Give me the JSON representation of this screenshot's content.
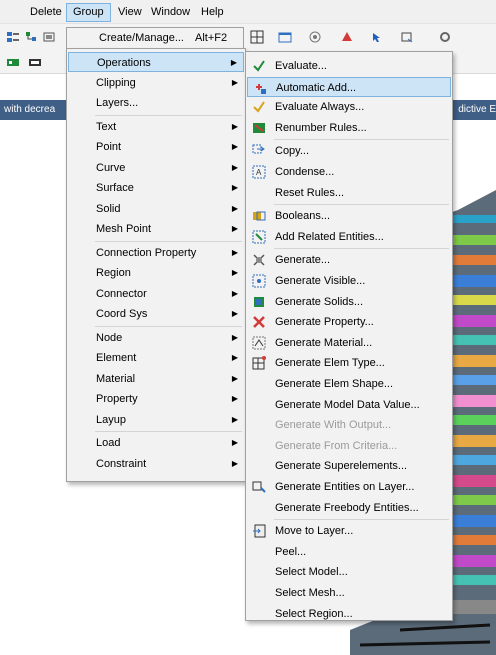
{
  "menubar": {
    "items": [
      "Delete",
      "Group",
      "View",
      "Window",
      "Help"
    ],
    "active": "Group"
  },
  "strip": {
    "left_text": "with decrea",
    "right_text": "dictive E"
  },
  "create_manage": {
    "label": "Create/Manage...",
    "shortcut": "Alt+F2"
  },
  "group_menu": {
    "items": [
      {
        "label": "Operations",
        "submenu": true,
        "highlighted": true
      },
      {
        "label": "Clipping",
        "submenu": true
      },
      {
        "label": "Layers...",
        "submenu": false
      },
      {
        "label": "Text",
        "submenu": true
      },
      {
        "label": "Point",
        "submenu": true
      },
      {
        "label": "Curve",
        "submenu": true
      },
      {
        "label": "Surface",
        "submenu": true
      },
      {
        "label": "Solid",
        "submenu": true
      },
      {
        "label": "Mesh Point",
        "submenu": true
      },
      {
        "label": "Connection Property",
        "submenu": true
      },
      {
        "label": "Region",
        "submenu": true
      },
      {
        "label": "Connector",
        "submenu": true
      },
      {
        "label": "Coord Sys",
        "submenu": true
      },
      {
        "label": "Node",
        "submenu": true
      },
      {
        "label": "Element",
        "submenu": true
      },
      {
        "label": "Material",
        "submenu": true
      },
      {
        "label": "Property",
        "submenu": true
      },
      {
        "label": "Layup",
        "submenu": true
      },
      {
        "label": "Load",
        "submenu": true
      },
      {
        "label": "Constraint",
        "submenu": true
      }
    ]
  },
  "operations_menu": {
    "items": [
      {
        "label": "Evaluate...",
        "icon": "evaluate-icon"
      },
      {
        "label": "Automatic Add...",
        "icon": "automatic-add-icon",
        "highlighted": true
      },
      {
        "label": "Evaluate Always...",
        "icon": "evaluate-always-icon"
      },
      {
        "label": "Renumber Rules...",
        "icon": "renumber-rules-icon"
      },
      {
        "label": "Copy...",
        "icon": "copy-icon"
      },
      {
        "label": "Condense...",
        "icon": "condense-icon"
      },
      {
        "label": "Reset Rules...",
        "icon": ""
      },
      {
        "label": "Booleans...",
        "icon": "booleans-icon"
      },
      {
        "label": "Add Related Entities...",
        "icon": "add-related-icon"
      },
      {
        "label": "Generate...",
        "icon": "generate-icon"
      },
      {
        "label": "Generate Visible...",
        "icon": "generate-visible-icon"
      },
      {
        "label": "Generate Solids...",
        "icon": "generate-solids-icon"
      },
      {
        "label": "Generate Property...",
        "icon": "generate-property-icon"
      },
      {
        "label": "Generate Material...",
        "icon": "generate-material-icon"
      },
      {
        "label": "Generate Elem Type...",
        "icon": "generate-elem-type-icon"
      },
      {
        "label": "Generate Elem Shape...",
        "icon": ""
      },
      {
        "label": "Generate Model Data Value...",
        "icon": ""
      },
      {
        "label": "Generate With Output...",
        "icon": "",
        "disabled": true
      },
      {
        "label": "Generate From Criteria...",
        "icon": "",
        "disabled": true
      },
      {
        "label": "Generate Superelements...",
        "icon": ""
      },
      {
        "label": "Generate Entities on Layer...",
        "icon": "generate-layer-icon"
      },
      {
        "label": "Generate Freebody Entities...",
        "icon": ""
      },
      {
        "label": "Move to Layer...",
        "icon": "move-to-layer-icon"
      },
      {
        "label": "Peel...",
        "icon": ""
      },
      {
        "label": "Select Model...",
        "icon": ""
      },
      {
        "label": "Select Mesh...",
        "icon": ""
      },
      {
        "label": "Select Region...",
        "icon": ""
      }
    ]
  },
  "colors": {
    "highlight": "#cde4f7",
    "highlight_border": "#7fb3df",
    "menu_bg": "#f2f2f2",
    "strip": "#3f5f86"
  }
}
